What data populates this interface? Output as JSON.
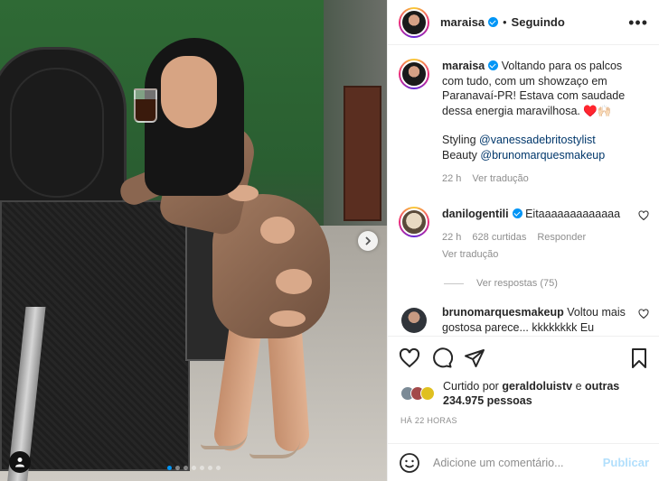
{
  "post": {
    "author": "maraisa",
    "follow_label": "Seguindo",
    "separator": "•",
    "more_label": "•••"
  },
  "caption": {
    "author": "maraisa",
    "text": "Voltando para os palcos com tudo, com um showzaço em Paranavaí-PR! Estava com saudade dessa energia maravilhosa. ♥️🙌🏻",
    "styling_label": "Styling",
    "styling_handle": "@vanessadebritostylist",
    "beauty_label": "Beauty",
    "beauty_handle": "@brunomarquesmakeup",
    "time": "22 h",
    "translate": "Ver tradução"
  },
  "comments": [
    {
      "author": "danilogentili",
      "text": "Eitaaaaaaaaaaaaa",
      "time": "22 h",
      "likes": "628 curtidas",
      "reply": "Responder",
      "translate": "Ver tradução",
      "view_replies": "Ver respostas (75)"
    },
    {
      "author": "brunomarquesmakeup",
      "text": "Voltou mais gostosa parece... kkkkkkkk Eu"
    }
  ],
  "likes": {
    "prefix": "Curtido por",
    "user": "geraldoluistv",
    "middle": "e",
    "others": "outras 234.975 pessoas"
  },
  "timestamp": "HÁ 22 HORAS",
  "add_comment": {
    "placeholder": "Adicione um comentário...",
    "publish": "Publicar"
  },
  "carousel": {
    "slides": 7,
    "active": 0
  },
  "colors": {
    "verified": "#0095f6",
    "link": "#00376b",
    "publish": "#b2dffc"
  }
}
